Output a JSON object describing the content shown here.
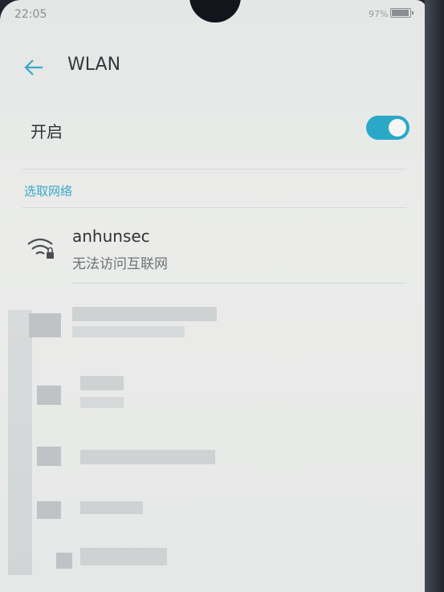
{
  "status_bar": {
    "time": "22:05",
    "battery_percent": "97%"
  },
  "app_bar": {
    "back_icon": "arrow-left-icon",
    "title": "WLAN"
  },
  "wlan_toggle": {
    "label": "开启",
    "state": "on",
    "accent_color": "#2aa8c8"
  },
  "section": {
    "header": "选取网络"
  },
  "networks": [
    {
      "name": "anhunsec",
      "status": "无法访问互联网",
      "icon": "wifi-lock-icon"
    }
  ],
  "colors": {
    "accent": "#3aa7c6",
    "title_text": "#34373b",
    "secondary_text": "#6e7276"
  }
}
